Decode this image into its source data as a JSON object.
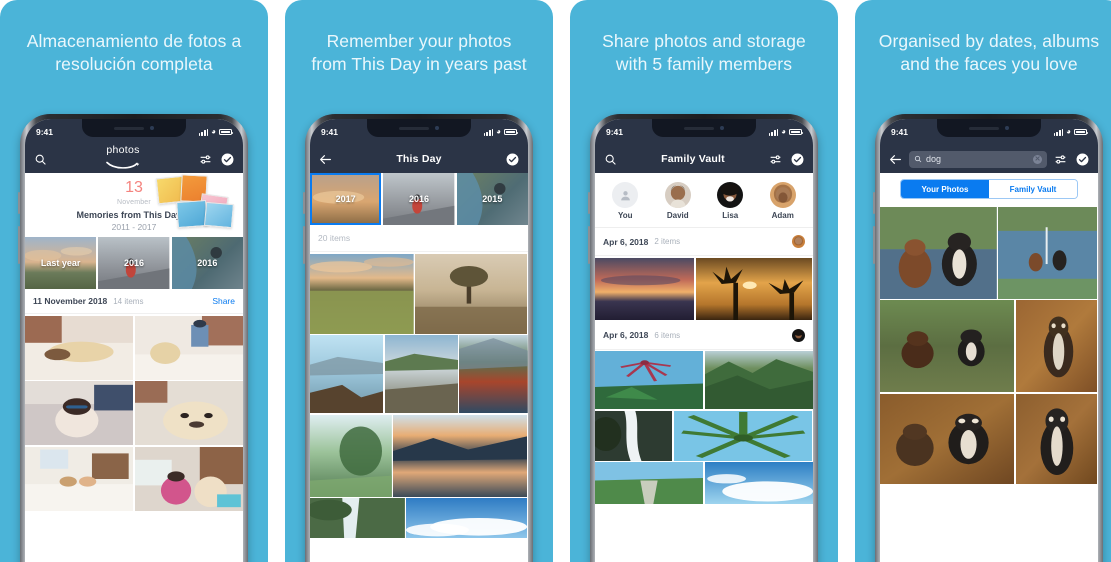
{
  "meta": {
    "panel_bg": "#4bb4d8",
    "nav_bg": "#2b3446",
    "accent_blue": "#0a7bf0",
    "coral": "#f4837e"
  },
  "panels": [
    {
      "caption": "Almacenamiento de fotos a\nresolución completa",
      "status": {
        "time": "9:41"
      },
      "nav": {
        "type": "wordmark",
        "wordmark": "photos",
        "left_icon": "search-icon",
        "right_icons": [
          "filter-icon",
          "check-circle-icon"
        ]
      },
      "memories": {
        "day": "13",
        "month": "November",
        "line1": "Memories from This Day in",
        "line2": "2011 - 2017"
      },
      "year_tiles": [
        {
          "label": "Last year",
          "selected": false
        },
        {
          "label": "2016",
          "selected": false
        },
        {
          "label": "2016",
          "selected": false
        }
      ],
      "section": {
        "date": "11 November 2018",
        "count": "14 items",
        "action": "Share"
      }
    },
    {
      "caption": "Remember your photos\nfrom This Day in years past",
      "status": {
        "time": "9:41"
      },
      "nav": {
        "type": "title",
        "title": "This Day",
        "left_icon": "back-arrow-icon",
        "right_icons": [
          "check-circle-icon"
        ]
      },
      "year_tiles": [
        {
          "label": "2017",
          "selected": true
        },
        {
          "label": "2016",
          "selected": false
        },
        {
          "label": "2015",
          "selected": false
        }
      ],
      "items_label": "20 items"
    },
    {
      "caption": "Share photos and storage\nwith 5 family members",
      "status": {
        "time": "9:41"
      },
      "nav": {
        "type": "title",
        "title": "Family Vault",
        "left_icon": "search-icon",
        "right_icons": [
          "filter-icon",
          "check-circle-icon"
        ]
      },
      "people": [
        {
          "name": "You",
          "placeholder": true
        },
        {
          "name": "David",
          "placeholder": false
        },
        {
          "name": "Lisa",
          "placeholder": false
        },
        {
          "name": "Adam",
          "placeholder": false
        }
      ],
      "sections": [
        {
          "date": "Apr 6, 2018",
          "count": "2 items"
        },
        {
          "date": "Apr 6, 2018",
          "count": "6 items"
        }
      ]
    },
    {
      "caption": "Organised by dates, albums\nand the faces you love",
      "status": {
        "time": "9:41"
      },
      "nav": {
        "type": "search",
        "left_icon": "back-arrow-icon",
        "search_value": "dog",
        "search_placeholder": "Search",
        "clear_icon": "clear-circle-icon",
        "right_icons": [
          "filter-icon",
          "check-circle-icon"
        ]
      },
      "segments": [
        {
          "label": "Your Photos",
          "active": true
        },
        {
          "label": "Family Vault",
          "active": false
        }
      ]
    }
  ]
}
